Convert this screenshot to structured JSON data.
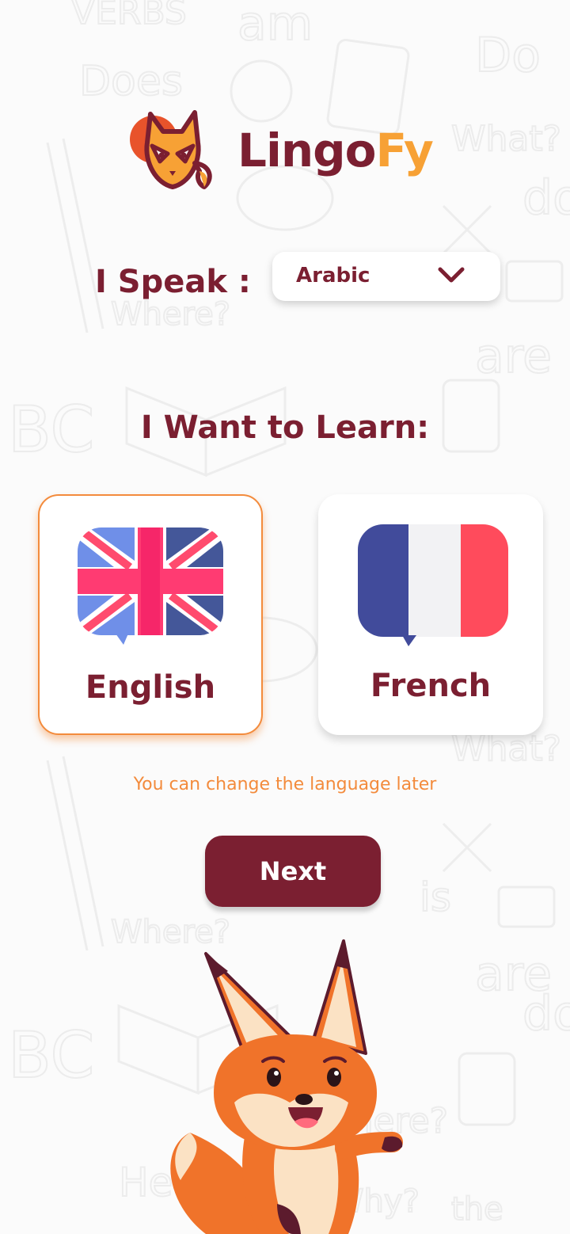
{
  "app": {
    "name_part1": "Lingo",
    "name_part2": "Fy"
  },
  "speak": {
    "label": "I Speak :",
    "selected": "Arabic"
  },
  "learn": {
    "label": "I Want to Learn:",
    "options": [
      {
        "label": "English",
        "flag_icon": "uk-flag-icon",
        "selected": true
      },
      {
        "label": "French",
        "flag_icon": "france-flag-icon",
        "selected": false
      }
    ]
  },
  "hint": "You can change the language later",
  "next_label": "Next",
  "colors": {
    "primary": "#7b1f31",
    "accent": "#f38b3c",
    "logo_accent": "#f7a135"
  }
}
